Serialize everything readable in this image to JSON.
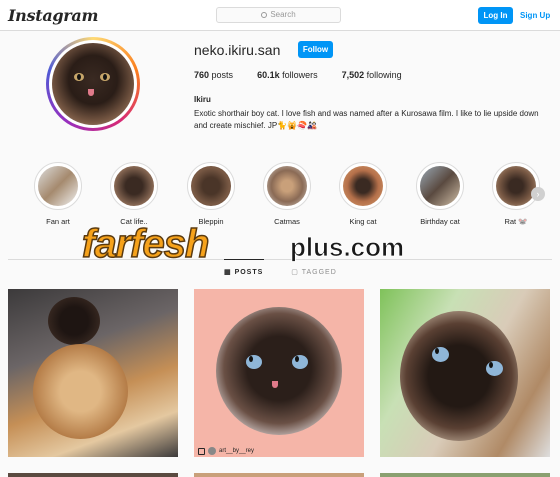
{
  "topbar": {
    "logo": "Instagram",
    "search_placeholder": "Search",
    "login_label": "Log In",
    "signup_label": "Sign Up"
  },
  "profile": {
    "username": "neko.ikiru.san",
    "follow_label": "Follow",
    "posts_count": "760",
    "posts_label": "posts",
    "followers_count": "60.1k",
    "followers_label": "followers",
    "following_count": "7,502",
    "following_label": "following",
    "name": "Ikiru",
    "bio": "Exotic shorthair boy cat. I love fish and was named after a Kurosawa film. I like to lie upside down and create mischief. JP🐈🙀🍣🎎"
  },
  "highlights": [
    {
      "label": "Fan art"
    },
    {
      "label": "Cat life.."
    },
    {
      "label": "Bleppin"
    },
    {
      "label": "Catmas"
    },
    {
      "label": "King cat"
    },
    {
      "label": "Birthday cat"
    },
    {
      "label": "Rat 🐭"
    }
  ],
  "tabs": {
    "posts": "POSTS",
    "tagged": "TAGGED"
  },
  "watermark": {
    "part1": "farfesh",
    "part2": "plus.com"
  },
  "posts": [
    {
      "credit": ""
    },
    {
      "credit": "art__by__rey"
    },
    {
      "credit": ""
    }
  ],
  "colors": {
    "accent": "#0095f6",
    "border": "#dbdbdb",
    "background": "#fafafa"
  }
}
